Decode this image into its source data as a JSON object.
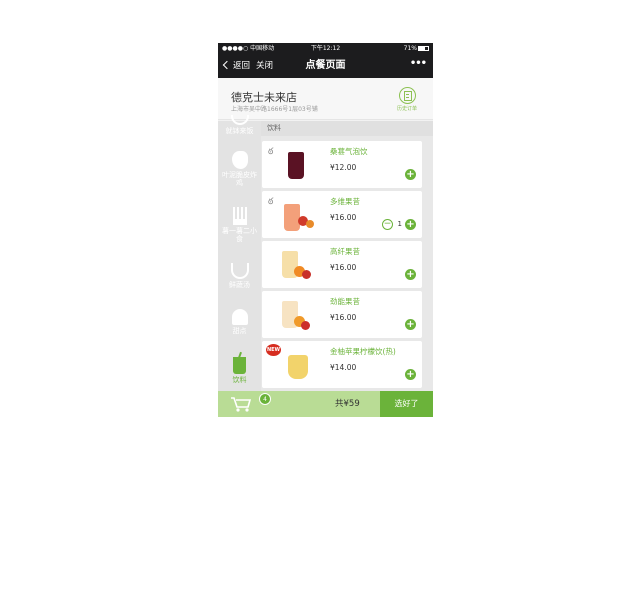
{
  "status_bar": {
    "carrier": "●●●●○ 中国移动",
    "time": "下午12:12",
    "battery": "71%"
  },
  "nav": {
    "back_label": "返回",
    "close_label": "关闭",
    "title": "点餐页面",
    "more_label": "•••"
  },
  "store": {
    "name": "德克士未来店",
    "address": "上海市吴中路1666号1层03号铺",
    "history_label": "历史订单"
  },
  "categories": [
    {
      "label": "就钵来饭",
      "icon": "rice-bowl-icon"
    },
    {
      "label": "叶泥脆皮炸鸡",
      "icon": "chicken-icon"
    },
    {
      "label": "薯一薯二小食",
      "icon": "fries-icon"
    },
    {
      "label": "鲜蔬汤",
      "icon": "soup-icon"
    },
    {
      "label": "甜点",
      "icon": "dessert-icon"
    },
    {
      "label": "饮料",
      "icon": "drink-icon",
      "active": true
    }
  ],
  "menu": {
    "section_label": "饮料",
    "items": [
      {
        "name": "桑葚气泡饮",
        "price": "¥12.00",
        "color": "#5a1224"
      },
      {
        "name": "多维果昔",
        "price": "¥16.00",
        "color": "#f3a07a",
        "quantity": "1"
      },
      {
        "name": "高纤果昔",
        "price": "¥16.00",
        "color": "#f6dfa8"
      },
      {
        "name": "劲能果昔",
        "price": "¥16.00",
        "color": "#f7e3c2"
      },
      {
        "name": "金柚苹果柠檬饮(热)",
        "price": "¥14.00",
        "color": "#f2d36b",
        "badge": "NEW"
      }
    ],
    "add_label": "+",
    "minus_label": "−"
  },
  "cart": {
    "count": "4",
    "total": "共¥59",
    "checkout_label": "选好了"
  },
  "colors": {
    "accent": "#6bb33a",
    "cart_bar": "#b9dc95",
    "nav_bg": "#1c1c1e"
  }
}
